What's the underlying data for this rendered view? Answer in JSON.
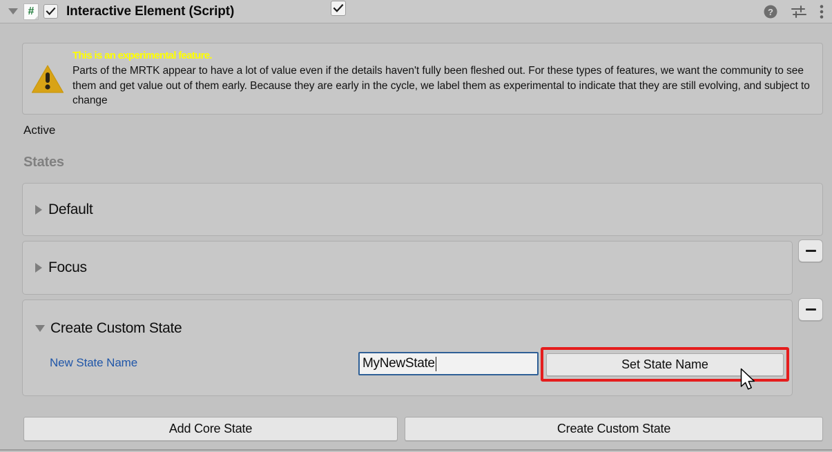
{
  "header": {
    "foldout_icon": "triangle-down-icon",
    "script_icon": "csharp-script-icon",
    "script_icon_glyph": "#",
    "enabled": true,
    "title": "Interactive Element (Script)",
    "help_icon": "help-icon",
    "preset_icon": "preset-sliders-icon",
    "menu_icon": "kebab-menu-icon"
  },
  "warning": {
    "icon": "warning-triangle-icon",
    "title": "This is an experimental feature.",
    "body": "Parts of the MRTK appear to have a lot of value even if the details haven't fully been fleshed out. For these types of features, we want the community to see them and get value out of them early. Because they are early in the cycle, we label them as experimental to indicate that they are still evolving, and subject to change",
    "title_color": "#ffff00"
  },
  "active": {
    "label": "Active",
    "checked": true
  },
  "states": {
    "heading": "States",
    "items": [
      {
        "label": "Default",
        "expanded": false,
        "removable": false
      },
      {
        "label": "Focus",
        "expanded": false,
        "removable": true
      },
      {
        "label": "Create Custom State",
        "expanded": true,
        "removable": true
      }
    ],
    "remove_button_label": "−"
  },
  "custom_state_form": {
    "field_label": "New State Name",
    "field_value": "MyNewState",
    "field_placeholder": "New State Name",
    "submit_label": "Set State Name",
    "highlight_color": "#e51d1d",
    "label_color": "#2056a8"
  },
  "footer": {
    "add_core_state_label": "Add Core State",
    "create_custom_state_label": "Create Custom State"
  },
  "cursor": {
    "icon": "arrow-pointer-icon"
  }
}
